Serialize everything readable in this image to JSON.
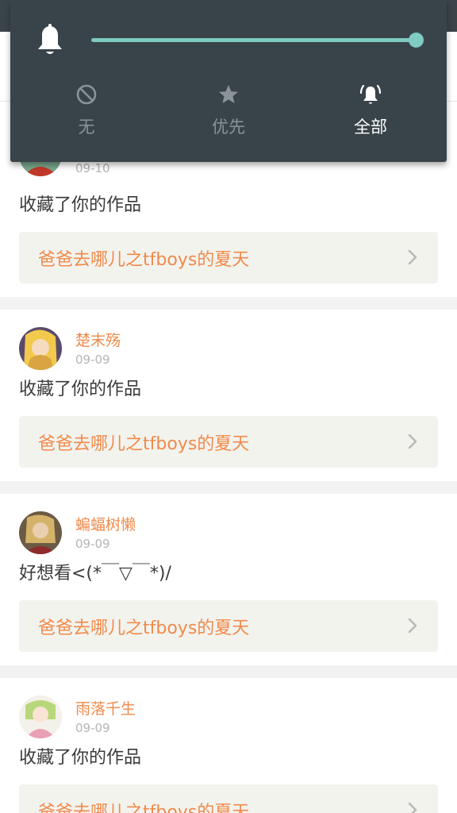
{
  "volume_panel": {
    "level": 1.0,
    "accent_color": "#80cbc4",
    "modes": [
      {
        "label": "无",
        "icon": "block-icon",
        "selected": false
      },
      {
        "label": "优先",
        "icon": "star-icon",
        "selected": false
      },
      {
        "label": "全部",
        "icon": "bell-alert-icon",
        "selected": true
      }
    ]
  },
  "feed": [
    {
      "username": "",
      "date": "09-10",
      "comment": "收藏了你的作品",
      "work_title": "爸爸去哪儿之tfboys的夏天"
    },
    {
      "username": "楚末殇",
      "date": "09-09",
      "comment": "收藏了你的作品",
      "work_title": "爸爸去哪儿之tfboys的夏天"
    },
    {
      "username": "蝙蝠树懒",
      "date": "09-09",
      "comment": "好想看<(*￣▽￣*)/",
      "work_title": "爸爸去哪儿之tfboys的夏天"
    },
    {
      "username": "雨落千生",
      "date": "09-09",
      "comment": "收藏了你的作品",
      "work_title": "爸爸去哪儿之tfboys的夏天"
    }
  ],
  "colors": {
    "username": "#f08a4b",
    "panel_bg": "#39434a"
  }
}
